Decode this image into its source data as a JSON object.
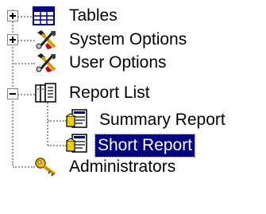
{
  "tree": {
    "nodes": [
      {
        "label": "Tables",
        "icon": "table-grid-icon",
        "expander": "collapsed"
      },
      {
        "label": "System Options",
        "icon": "tools-icon",
        "expander": "collapsed"
      },
      {
        "label": "User Options",
        "icon": "tools-icon",
        "expander": "none"
      },
      {
        "label": "Report List",
        "icon": "report-book-icon",
        "expander": "expanded"
      },
      {
        "label": "Summary Report",
        "icon": "report-page-icon",
        "expander": "none"
      },
      {
        "label": "Short Report",
        "icon": "report-page-icon",
        "expander": "none",
        "selected": true
      },
      {
        "label": "Administrators",
        "icon": "key-icon",
        "expander": "none"
      }
    ]
  },
  "colors": {
    "selection_background": "#000080",
    "selection_text": "#ffffff",
    "connector": "#9a9a9a"
  }
}
